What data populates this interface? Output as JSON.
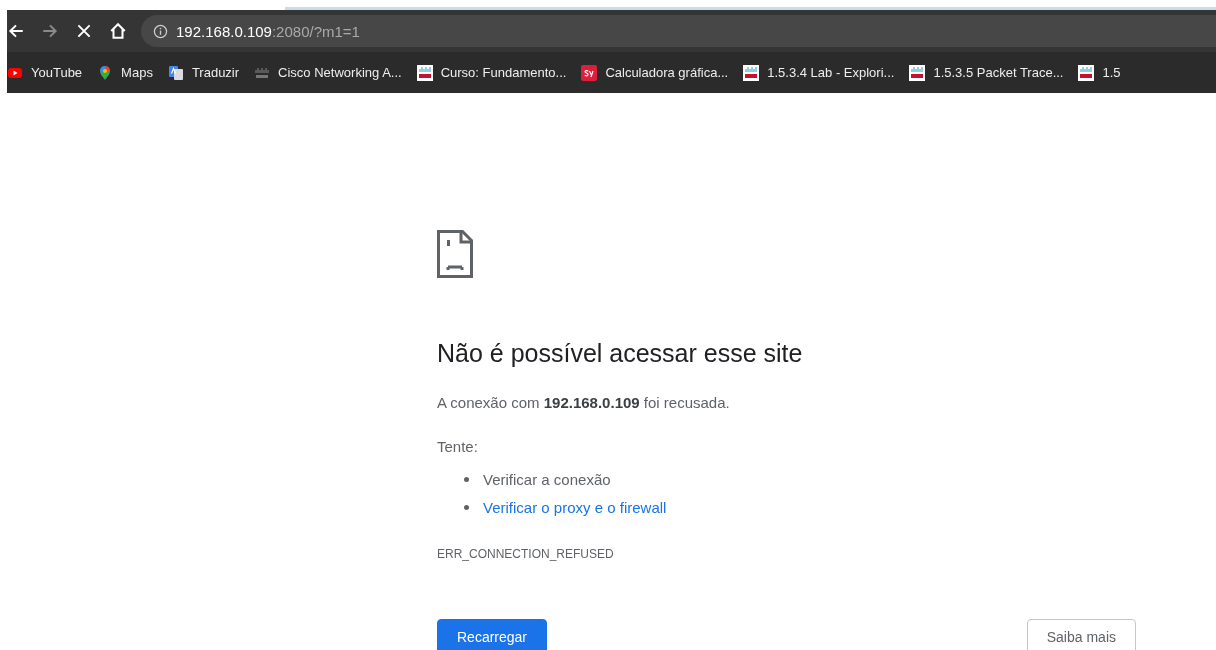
{
  "toolbar": {
    "address": {
      "host": "192.168.0.109",
      "rest": ":2080/?m1=1"
    }
  },
  "bookmarks": [
    {
      "kind": "youtube",
      "label": "YouTube"
    },
    {
      "kind": "maps",
      "label": "Maps"
    },
    {
      "kind": "translate",
      "label": "Traduzir"
    },
    {
      "kind": "cisco-dark",
      "label": "Cisco Networking A..."
    },
    {
      "kind": "cisco",
      "label": "Curso: Fundamento..."
    },
    {
      "kind": "sy",
      "label": "Calculadora gráfica..."
    },
    {
      "kind": "cisco",
      "label": "1.5.3.4 Lab - Explori..."
    },
    {
      "kind": "cisco",
      "label": "1.5.3.5 Packet Trace..."
    },
    {
      "kind": "cisco",
      "label": "1.5"
    }
  ],
  "error_page": {
    "heading": "Não é possível acessar esse site",
    "message": "A conexão com **192.168.0.109** foi recusada.",
    "try_label": "Tente:",
    "suggestions": [
      {
        "kind": "text",
        "label": "Verificar a conexão"
      },
      {
        "kind": "link",
        "label": "Verificar o proxy e o firewall"
      }
    ],
    "error_code": "ERR_CONNECTION_REFUSED",
    "buttons": [
      {
        "kind": "primary",
        "label": "Recarregar"
      },
      {
        "kind": "secondary",
        "label": "Saiba mais"
      }
    ]
  }
}
